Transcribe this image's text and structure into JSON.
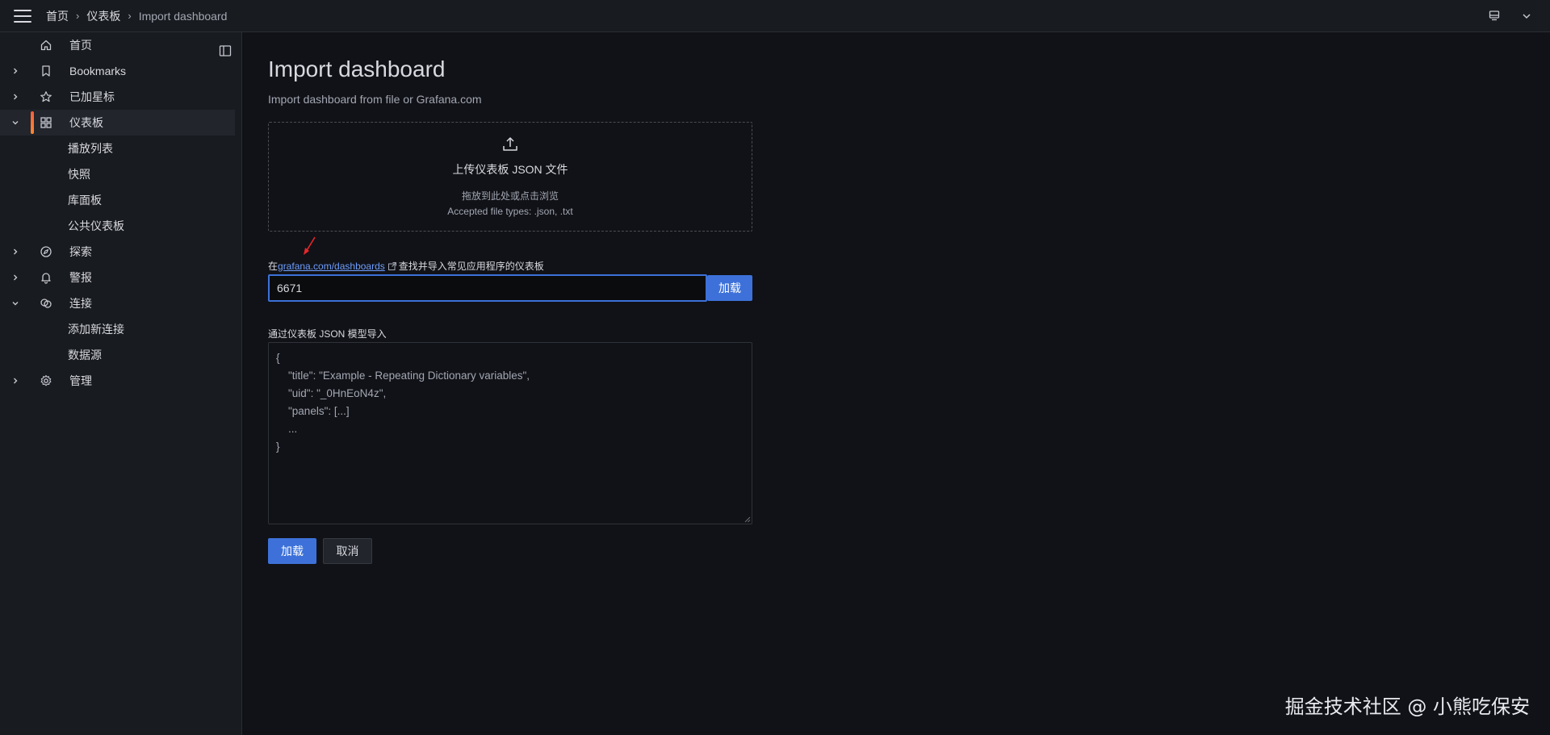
{
  "breadcrumbs": [
    "首页",
    "仪表板",
    "Import dashboard"
  ],
  "sidebar": {
    "items": [
      {
        "label": "首页",
        "icon": "home-icon",
        "expandable": false
      },
      {
        "label": "Bookmarks",
        "icon": "bookmark-icon",
        "expandable": true
      },
      {
        "label": "已加星标",
        "icon": "star-icon",
        "expandable": true
      },
      {
        "label": "仪表板",
        "icon": "apps-icon",
        "expandable": true,
        "expanded": true,
        "active": true,
        "children": [
          "播放列表",
          "快照",
          "库面板",
          "公共仪表板"
        ]
      },
      {
        "label": "探索",
        "icon": "compass-icon",
        "expandable": true
      },
      {
        "label": "警报",
        "icon": "bell-icon",
        "expandable": true
      },
      {
        "label": "连接",
        "icon": "link-icon",
        "expandable": true,
        "expanded": true,
        "children": [
          "添加新连接",
          "数据源"
        ]
      },
      {
        "label": "管理",
        "icon": "gear-icon",
        "expandable": true
      }
    ]
  },
  "main": {
    "title": "Import dashboard",
    "subtitle": "Import dashboard from file or Grafana.com",
    "upload": {
      "title": "上传仪表板 JSON 文件",
      "hint": "拖放到此处或点击浏览",
      "types": "Accepted file types: .json, .txt"
    },
    "grafana_com": {
      "prefix": "在",
      "link": "grafana.com/dashboards",
      "suffix": "查找并导入常见应用程序的仪表板",
      "value": "6671",
      "load_label": "加载"
    },
    "json_model": {
      "label": "通过仪表板 JSON 模型导入",
      "placeholder": "{\n    \"title\": \"Example - Repeating Dictionary variables\",\n    \"uid\": \"_0HnEoN4z\",\n    \"panels\": [...]\n    ...\n}"
    },
    "buttons": {
      "load": "加载",
      "cancel": "取消"
    }
  },
  "watermark": "掘金技术社区 @ 小熊吃保安",
  "colors": {
    "accent": "#3d71d9",
    "active_bar": "#f55f3e",
    "link": "#6e9fff",
    "background": "#111217",
    "panel": "#181b1f"
  }
}
